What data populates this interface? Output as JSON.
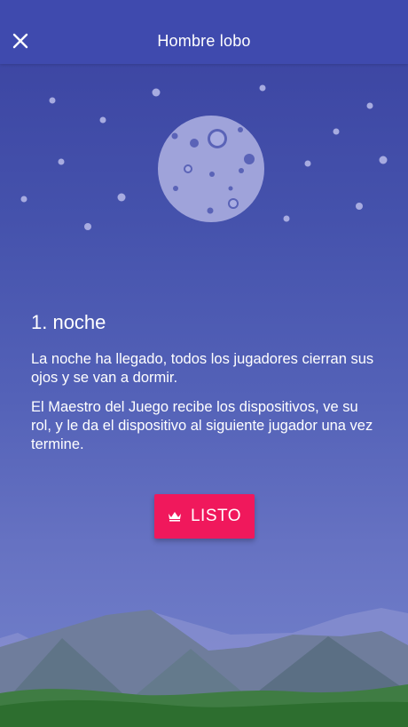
{
  "header": {
    "title": "Hombre lobo",
    "close_icon": "close-icon"
  },
  "night": {
    "heading": "1. noche",
    "paragraph_1": "La noche ha llegado, todos los jugadores cierran sus ojos y se van a dormir.",
    "paragraph_2": "El Maestro del Juego recibe los dispositivos, ve su rol, y le da el dispositivo al siguiente jugador una vez termine."
  },
  "ready_button": {
    "label": "LISTO",
    "icon": "crown-icon",
    "color": "#f0185c"
  },
  "colors": {
    "app_bar": "#3f4aae",
    "sky_top": "#3a42a0",
    "sky_bottom": "#7483cc",
    "hills": "#2d6e2f"
  }
}
